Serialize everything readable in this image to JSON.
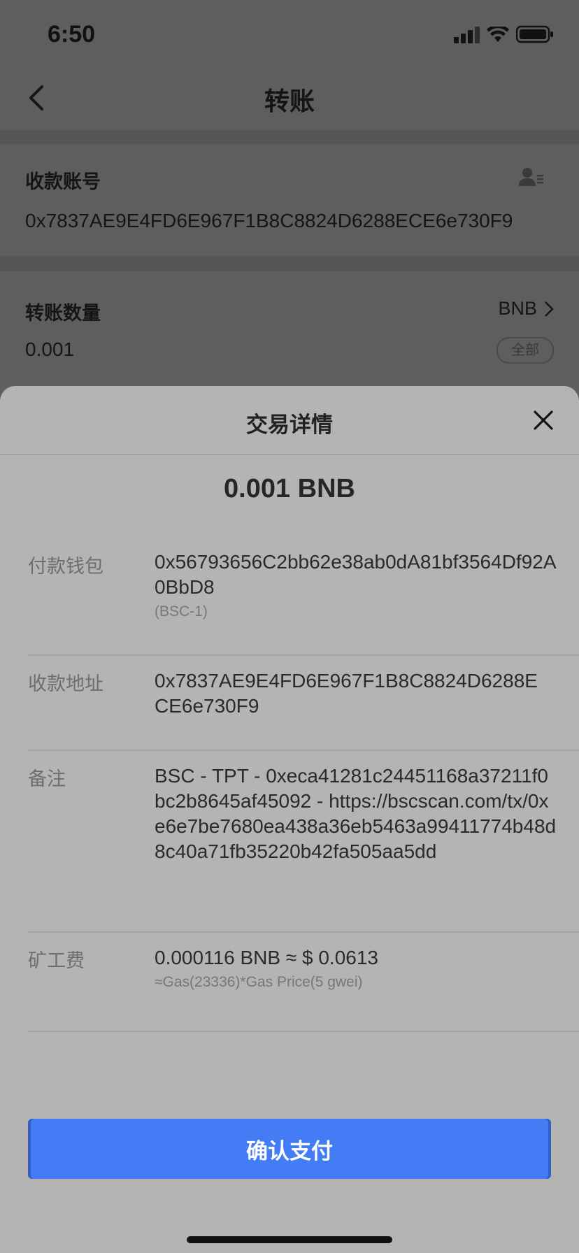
{
  "status_bar": {
    "time": "6:50"
  },
  "nav": {
    "title": "转账"
  },
  "recipient_card": {
    "label": "收款账号",
    "value": "0x7837AE9E4FD6E967F1B8C8824D6288ECE6e730F9"
  },
  "amount_card": {
    "label": "转账数量",
    "token": "BNB",
    "value": "0.001",
    "all_label": "全部"
  },
  "sheet": {
    "title": "交易详情",
    "amount": "0.001 BNB",
    "rows": [
      {
        "label": "付款钱包",
        "value": "0x56793656C2bb62e38ab0dA81bf3564Df92A0BbD8",
        "sub": "(BSC-1)"
      },
      {
        "label": "收款地址",
        "value": "0x7837AE9E4FD6E967F1B8C8824D6288ECE6e730F9"
      },
      {
        "label": "备注",
        "value": "BSC - TPT - 0xeca41281c24451168a37211f0bc2b8645af45092 - https://bscscan.com/tx/0xe6e7be7680ea438a36eb5463a99411774b48d8c40a71fb35220b42fa505aa5dd"
      },
      {
        "label": "矿工费",
        "value": "0.000116 BNB ≈ $ 0.0613",
        "sub": "≈Gas(23336)*Gas Price(5 gwei)"
      }
    ],
    "confirm_label": "确认支付"
  },
  "colors": {
    "primary_button": "#437cf4",
    "sheet_bg": "#b4b4b4",
    "overlay_bg": "#5e5e5e"
  },
  "icons": [
    "back-arrow-icon",
    "contact-list-icon",
    "chevron-right-icon",
    "close-icon",
    "signal-icon",
    "wifi-icon",
    "battery-icon"
  ]
}
